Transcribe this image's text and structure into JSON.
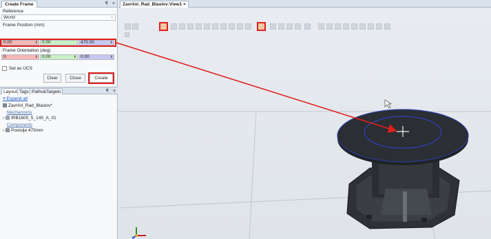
{
  "create_frame": {
    "title": "Create Frame",
    "window_controls": [
      "₹",
      "×"
    ],
    "reference_label": "Reference",
    "reference_value": "World",
    "position_label": "Frame Position (mm)",
    "position_x": "0.00",
    "position_y": "0.00",
    "position_z": "475.00",
    "orientation_label": "Frame Orientation (deg)",
    "orientation_x": "0",
    "orientation_y": "0.00",
    "orientation_z": "0.00",
    "set_ucs_label": "Set as UCS",
    "clear_label": "Clear",
    "close_label": "Close",
    "create_label": "Create"
  },
  "layout_panel": {
    "tabs": [
      "Layout",
      "Tags",
      "Paths&Targets"
    ],
    "window_controls": [
      "₹",
      "×"
    ],
    "expand_all": "Expand all",
    "station": "Završni_Rad_Blaslov*",
    "mechanisms_label": "Mechanisms",
    "mechanism": "IRB1600_5_145_A_01",
    "components_label": "Components",
    "component": "Postolje 475mm"
  },
  "document": {
    "tab_label": "Završni_Rad_Blaslov:View1",
    "close_glyph": "×"
  },
  "icons": [
    "grid-icon",
    "snap-object-icon",
    "snap-center-icon",
    "coordinate-axis-icon",
    "cursor-icon"
  ],
  "colors": {
    "highlight_red": "#e0201c",
    "x_field": "#f6b7b7",
    "y_field": "#c9f0c4",
    "z_field": "#c7c7f2",
    "link_blue": "#1a56c9"
  }
}
